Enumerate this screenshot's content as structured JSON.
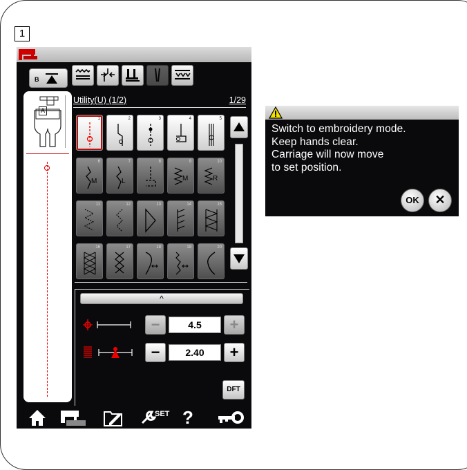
{
  "step_label": "1",
  "colors": {
    "screen_bg": "#0a0a0c",
    "accent_red": "#d00000",
    "titlebar": "#c8c8c8"
  },
  "topbar": {
    "icon": "sewing-machine-red-icon"
  },
  "left_panel": {
    "presser_foot_button": {
      "letter": "B",
      "icon": "presser-lift-icon"
    },
    "foot": {
      "letter": "A",
      "icon": "presser-foot-icon"
    }
  },
  "mode_icons": [
    "feed-dog-icon",
    "stitch-direction-icon",
    "foot-pressure-icon",
    "twin-needle-icon",
    "bobbin-thread-icon"
  ],
  "category": {
    "name": "Utility(U) (1/2)",
    "page": "1/29"
  },
  "patterns": [
    {
      "number": "1",
      "suffix": ""
    },
    {
      "number": "2",
      "suffix": ""
    },
    {
      "number": "3",
      "suffix": ""
    },
    {
      "number": "4",
      "suffix": ""
    },
    {
      "number": "5",
      "suffix": ""
    },
    {
      "number": "6",
      "suffix": "M"
    },
    {
      "number": "7",
      "suffix": "L"
    },
    {
      "number": "8",
      "suffix": ""
    },
    {
      "number": "9",
      "suffix": "M"
    },
    {
      "number": "10",
      "suffix": "R"
    },
    {
      "number": "11",
      "suffix": ""
    },
    {
      "number": "12",
      "suffix": ""
    },
    {
      "number": "13",
      "suffix": ""
    },
    {
      "number": "14",
      "suffix": ""
    },
    {
      "number": "15",
      "suffix": ""
    },
    {
      "number": "16",
      "suffix": ""
    },
    {
      "number": "17",
      "suffix": ""
    },
    {
      "number": "18",
      "suffix": ""
    },
    {
      "number": "19",
      "suffix": ""
    },
    {
      "number": "20",
      "suffix": ""
    }
  ],
  "selected_pattern": "1",
  "settings": {
    "collapse_label": "^",
    "needle_position": {
      "value": "4.5",
      "minus": "−",
      "plus": "+"
    },
    "thread_tension": {
      "value": "2.40",
      "minus": "−",
      "plus": "+"
    },
    "default_button": "DFT"
  },
  "bottom_bar": {
    "items": [
      "home-icon",
      "sewing-mode-icon",
      "open-file-icon",
      "set-icon",
      "help-icon",
      "key-icon"
    ],
    "set_label": "SET",
    "help_label": "?"
  },
  "dialog": {
    "icon": "warning-icon",
    "lines": [
      "Switch to embroidery mode.",
      "Keep hands clear.",
      "Carriage will now move",
      "to set position."
    ],
    "ok_label": "OK",
    "cancel_label": "✕"
  }
}
